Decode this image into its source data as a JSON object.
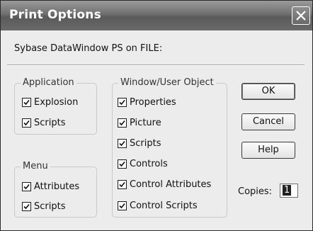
{
  "dialog": {
    "title": "Print Options",
    "printer_info": "Sybase DataWindow PS on FILE:"
  },
  "groups": {
    "application": {
      "label": "Application",
      "items": [
        {
          "label": "Explosion",
          "checked": true
        },
        {
          "label": "Scripts",
          "checked": true
        }
      ]
    },
    "menu": {
      "label": "Menu",
      "items": [
        {
          "label": "Attributes",
          "checked": true
        },
        {
          "label": "Scripts",
          "checked": true
        }
      ]
    },
    "window_user_object": {
      "label": "Window/User Object",
      "items": [
        {
          "label": "Properties",
          "checked": true
        },
        {
          "label": "Picture",
          "checked": true
        },
        {
          "label": "Scripts",
          "checked": true
        },
        {
          "label": "Controls",
          "checked": true
        },
        {
          "label": "Control Attributes",
          "checked": true
        },
        {
          "label": "Control Scripts",
          "checked": true
        }
      ]
    }
  },
  "buttons": {
    "ok": "OK",
    "cancel": "Cancel",
    "help": "Help"
  },
  "copies": {
    "label": "Copies:",
    "value": "1"
  },
  "icons": {
    "close": "close-icon",
    "check": "checkmark-icon"
  },
  "colors": {
    "titlebar": "#6f6f6f",
    "dialog_background": "#ececec"
  }
}
